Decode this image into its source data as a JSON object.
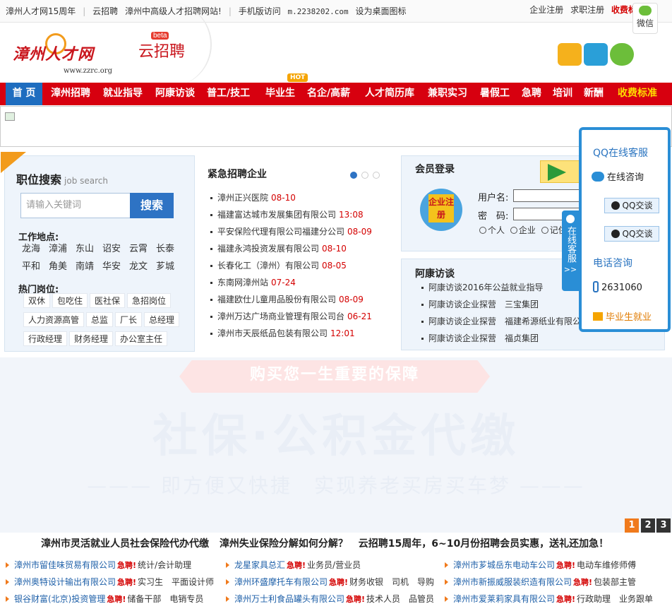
{
  "topbar": {
    "left": [
      "漳州人才网15周年",
      "云招聘",
      "漳州中高级人才招聘网站!",
      "手机版访问",
      "m.2238202.com",
      "设为桌面图标"
    ],
    "right": [
      "企业注册",
      "求职注册",
      "收费标"
    ]
  },
  "wechat_badge": "微信",
  "logo": {
    "main": "漳州人才网",
    "sub": "www.zzrc.org"
  },
  "yun": {
    "text": "云招聘",
    "beta": "beta"
  },
  "nav": {
    "items": [
      "首 页",
      "漳州招聘",
      "就业指导",
      "阿康访谈",
      "普工/技工",
      "毕业生",
      "名企/高薪",
      "人才简历库",
      "兼职实习",
      "暑假工",
      "急聘",
      "培训",
      "新酬",
      "收费标准"
    ],
    "hot": "HOT"
  },
  "search": {
    "title": "职位搜索",
    "title_en": "job search",
    "placeholder": "请输入关键词",
    "button": "搜索",
    "loc_title": "工作地点:",
    "locations": [
      "龙海",
      "漳浦",
      "东山",
      "诏安",
      "云霄",
      "长泰",
      "平和",
      "角美",
      "南靖",
      "华安",
      "龙文",
      "芗城"
    ],
    "jobs_title": "热门岗位:",
    "jobs": [
      "双休",
      "包吃住",
      "医社保",
      "急招岗位",
      "人力资源高管",
      "总监",
      "厂长",
      "总经理",
      "行政经理",
      "财务经理",
      "办公室主任"
    ]
  },
  "urgent": {
    "title": "紧急招聘企业",
    "items": [
      {
        "name": "漳州正兴医院",
        "time": "08-10"
      },
      {
        "name": "福建富达城市发展集团有限公司",
        "time": "13:08"
      },
      {
        "name": "平安保险代理有限公司福建分公司",
        "time": "08-09"
      },
      {
        "name": "福建永鸿投资发展有限公司",
        "time": "08-10"
      },
      {
        "name": "长春化工（漳州）有限公司",
        "time": "08-05"
      },
      {
        "name": "东南网漳州站",
        "time": "07-24"
      },
      {
        "name": "福建欧仕儿童用品股份有限公司",
        "time": "08-09"
      },
      {
        "name": "漳州万达广场商业管理有限公司台",
        "time": "06-21"
      },
      {
        "name": "漳州市天辰纸品包装有限公司",
        "time": "12:01"
      }
    ]
  },
  "login": {
    "title": "会员登录",
    "reg": "企业注册",
    "username": "用户名:",
    "password": "密　码:",
    "radios": [
      "个人",
      "企业",
      "记住"
    ]
  },
  "akang": {
    "title": "阿康访谈",
    "items": [
      "阿康访谈2016年公益就业指导",
      "阿康访谈企业探营　三宝集团",
      "阿康访谈企业探营　福建希源纸业有限公司",
      "阿康访谈企业探营　福贞集团"
    ]
  },
  "qq": {
    "title": "QQ在线客服",
    "online": "在线咨询",
    "btn1": "QQ交谈",
    "btn2": "QQ交谈",
    "phone_title": "电话咨询",
    "phone": "2631060",
    "grad": "毕业生就业",
    "tab": "在线客服",
    "tab_arrow": ">>"
  },
  "promo": {
    "ribbon": "购买您一生重要的保障",
    "big": "社保·公积金代缴",
    "slogan": "——— 即方便又快捷　实现养老买房买车梦 ———",
    "pages": [
      "1",
      "2",
      "3"
    ]
  },
  "marquee": [
    "漳州市灵活就业人员社会保险代办代缴",
    "漳州失业保险分解如何分解？",
    "云招聘15周年，6~10月份招聘会员实惠，送礼还加急！"
  ],
  "joblist": [
    {
      "co": "漳州市留佳味贸易有限公司",
      "tag": "急聘!",
      "pos": "统计/会计助理"
    },
    {
      "co": "龙星家具总汇",
      "tag": "急聘!",
      "pos": "业务员/营业员"
    },
    {
      "co": "漳州市芗城岳东电动车公司",
      "tag": "急聘!",
      "pos": "电动车维修师傅"
    },
    {
      "co": "漳州奥特设计输出有限公司",
      "tag": "急聘!",
      "pos": "实习生　平面设计师"
    },
    {
      "co": "漳州环盛摩托车有限公司",
      "tag": "急聘!",
      "pos": "财务收银　司机　导购"
    },
    {
      "co": "漳州市新振威服装织造有限公司",
      "tag": "急聘!",
      "pos": "包装部主管"
    },
    {
      "co": "银谷财富(北京)投资管理",
      "tag": "急聘!",
      "pos": "储备干部　电销专员"
    },
    {
      "co": "漳州万士利食品罐头有限公司",
      "tag": "急聘!",
      "pos": "技术人员　品管员"
    },
    {
      "co": "漳州市爱莱莉家具有限公司",
      "tag": "急聘!",
      "pos": "行政助理　业务跟单"
    }
  ]
}
